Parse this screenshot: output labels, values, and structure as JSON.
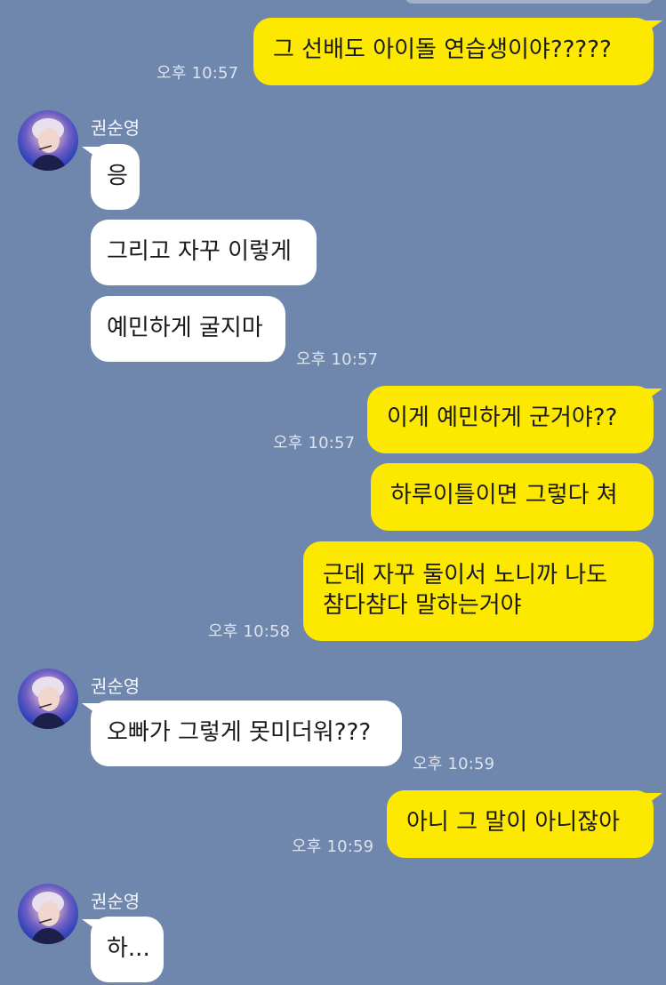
{
  "contact": {
    "name": "권순영"
  },
  "messages": [
    {
      "id": "m1",
      "side": "me",
      "text": "그 선배도 아이돌 연습생이야?????",
      "time": "오후 10:57"
    },
    {
      "id": "m2",
      "side": "them",
      "text": "응"
    },
    {
      "id": "m3",
      "side": "them",
      "text": "그리고 자꾸 이렇게"
    },
    {
      "id": "m4",
      "side": "them",
      "text": "예민하게 굴지마",
      "time": "오후 10:57"
    },
    {
      "id": "m5",
      "side": "me",
      "text": "이게 예민하게 군거야??",
      "time": "오후 10:57"
    },
    {
      "id": "m6",
      "side": "me",
      "text": "하루이틀이면 그렇다 쳐"
    },
    {
      "id": "m7",
      "side": "me",
      "line1": "근데 자꾸 둘이서 노니까 나도",
      "line2": "참다참다 말하는거야",
      "time": "오후 10:58"
    },
    {
      "id": "m8",
      "side": "them",
      "text": "오빠가 그렇게 못미더워???",
      "time": "오후 10:59"
    },
    {
      "id": "m9",
      "side": "me",
      "text": "아니 그 말이 아니잖아",
      "time": "오후 10:59"
    },
    {
      "id": "m10",
      "side": "them",
      "text": "하..."
    }
  ],
  "colors": {
    "background": "#6f87ad",
    "my_bubble": "#fde900",
    "their_bubble": "#ffffff"
  },
  "icons": {
    "avatar": "profile-photo-avatar"
  }
}
